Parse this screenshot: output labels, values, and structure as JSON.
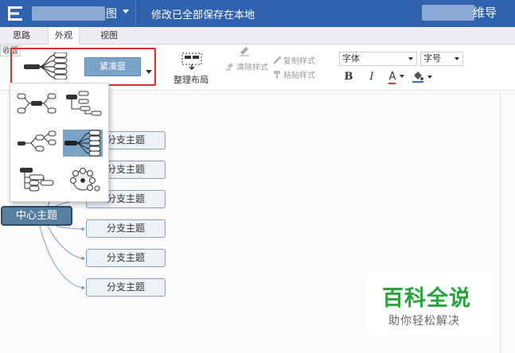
{
  "titlebar": {
    "title_tail": "图",
    "save_status": "修改已全部保存在本地",
    "right_title": "维导"
  },
  "tabs": [
    {
      "label": "思路"
    },
    {
      "label": "外观"
    },
    {
      "label": "视图"
    }
  ],
  "toolbar": {
    "collapse_label": "收版",
    "theme_label": "紧凑蓝",
    "arrange_label": "整理布局",
    "copy_style": "复制样式",
    "paste_style": "粘贴样式",
    "clear_style": "清除样式",
    "font_family": "字体",
    "font_size": "字号",
    "bold": "B",
    "italic": "I",
    "font_color": "A"
  },
  "colors": {
    "titlebar": "#2f63b0",
    "theme_button": "#7ba3c8",
    "highlight_border": "#e0302a",
    "central_node": "#557e9f",
    "branch_border": "#7fa0be",
    "connector": "#7fa0be",
    "watermark_green": "#26a63a"
  },
  "mindmap": {
    "central": "中心主题",
    "branches": [
      "分支主题",
      "分支主题",
      "分支主题",
      "分支主题",
      "分支主题",
      "分支主题"
    ]
  },
  "layout_dropdown": {
    "options": [
      "mind-map-layout",
      "org-chart-layout",
      "logic-layout",
      "right-fishbone-layout",
      "tree-layout",
      "fish-bubble-layout"
    ],
    "selected_index": 3
  },
  "watermark": {
    "big": "百科全说",
    "small": "助你轻松解决"
  }
}
